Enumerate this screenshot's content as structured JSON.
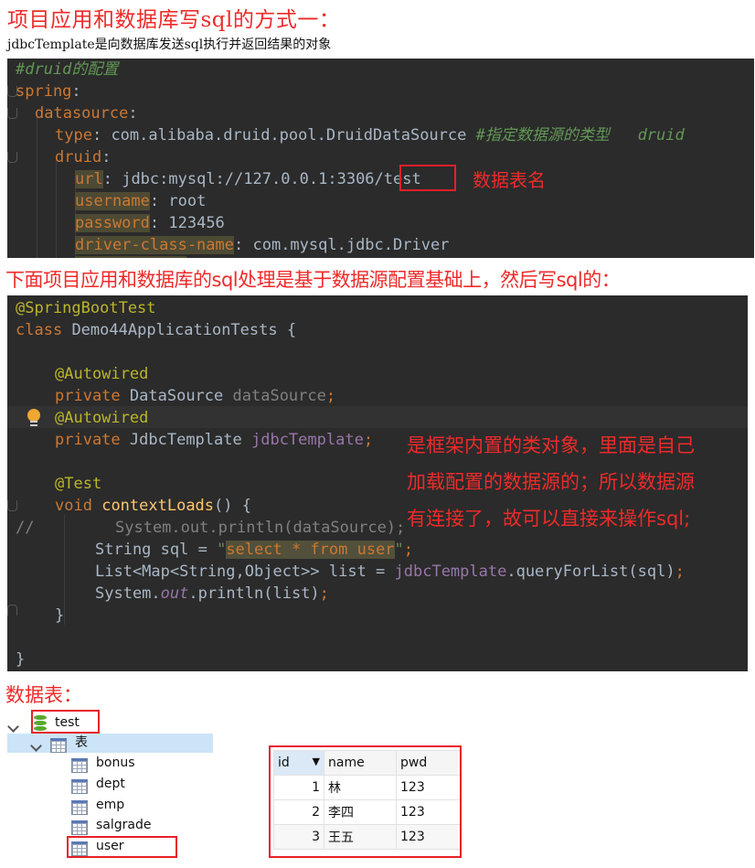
{
  "headings": {
    "title": "项目应用和数据库写sql的方式一：",
    "subtitle": "jdbcTemplate是向数据库发送sql执行并返回结果的对象",
    "section2": "下面项目应用和数据库的sql处理是基于数据源配置基础上，然后写sql的：",
    "section3": "数据表："
  },
  "yaml_config": {
    "comment": "#druid的配置",
    "spring_key": "spring",
    "datasource_key": "datasource",
    "type_key": "type",
    "type_value": "com.alibaba.druid.pool.DruidDataSource",
    "type_comment": "#指定数据源的类型   druid",
    "druid_key": "druid",
    "url_key": "url",
    "url_prefix": "jdbc:mysql://127.0.0.1:3306/",
    "url_db": "test",
    "username_key": "username",
    "username_value": "root",
    "password_key": "password",
    "password_value": "123456",
    "driver_key": "driver-class-name",
    "driver_value": "com.mysql.jdbc.Driver",
    "annotation_db_name": "数据表名"
  },
  "java_code": {
    "annotation_springboot": "@SpringBootTest",
    "class_kw": "class",
    "class_name": "Demo44ApplicationTests {",
    "autowired": "@Autowired",
    "private_kw": "private",
    "ds_type": "DataSource",
    "ds_field": "dataSource",
    "jt_type": "JdbcTemplate",
    "jt_field": "jdbcTemplate",
    "test_ann": "@Test",
    "void_kw": "void",
    "method_name": "contextLoads",
    "method_rest": "() {",
    "comment_marker": "//",
    "commented_line": "System.out.println(dataSource);",
    "sql_decl": "String sql = ",
    "sql_value": "select * from user",
    "list_decl": "List<Map<String,Object>> list = ",
    "list_call": ".queryForList(sql)",
    "print_prefix": "System.",
    "print_out": "out",
    "print_rest": ".println(list)",
    "close_method": "}",
    "close_class": "}",
    "note_lines": [
      "是框架内置的类对象，里面是自己",
      "加载配置的数据源的；所以数据源",
      "有连接了，故可以直接来操作sql;"
    ]
  },
  "db_tree": {
    "database": "test",
    "tables_folder": "表",
    "tables": [
      "bonus",
      "dept",
      "emp",
      "salgrade",
      "user"
    ],
    "selected_table": "user"
  },
  "user_table": {
    "columns": [
      "id",
      "name",
      "pwd"
    ],
    "sorted_column": "id",
    "rows": [
      {
        "id": "1",
        "name": "林",
        "pwd": "123"
      },
      {
        "id": "2",
        "name": "李四",
        "pwd": "123"
      },
      {
        "id": "3",
        "name": "王五",
        "pwd": "123"
      }
    ]
  },
  "colors": {
    "annotation_red": "#ee2a2a",
    "editor_bg": "#2b2b2b",
    "keyword": "#cc7832",
    "annotation": "#bbb529",
    "field": "#9876aa",
    "comment": "#629755"
  }
}
